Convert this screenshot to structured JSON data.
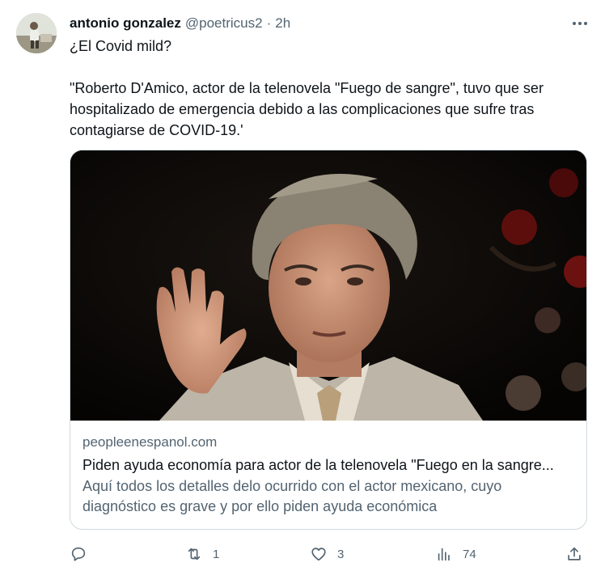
{
  "tweet": {
    "author_name": "antonio gonzalez",
    "handle": "@poetricus2",
    "separator": "·",
    "time": "2h",
    "text_line1": "¿El Covid mild?",
    "text_line2": "\"Roberto D'Amico, actor de la telenovela \"Fuego de sangre\", tuvo que ser hospitalizado de emergencia debido a las complicaciones que sufre tras contagiarse de COVID-19.'"
  },
  "link_card": {
    "domain": "peopleenespanol.com",
    "title": "Piden ayuda economía para actor de la telenovela \"Fuego en la sangre...",
    "description": "Aquí todos los detalles delo ocurrido con el actor mexicano, cuyo diagnóstico es grave y por ello piden ayuda económica"
  },
  "actions": {
    "reply_count": "",
    "retweet_count": "1",
    "like_count": "3",
    "views_count": "74"
  },
  "icons": {
    "more": "more-dots-icon",
    "reply": "reply-bubble-icon",
    "retweet": "retweet-arrows-icon",
    "like": "heart-icon",
    "views": "bar-chart-icon",
    "share": "share-upload-icon"
  },
  "colors": {
    "text_primary": "#0f1419",
    "text_secondary": "#536471",
    "card_border": "#cfd9de"
  }
}
